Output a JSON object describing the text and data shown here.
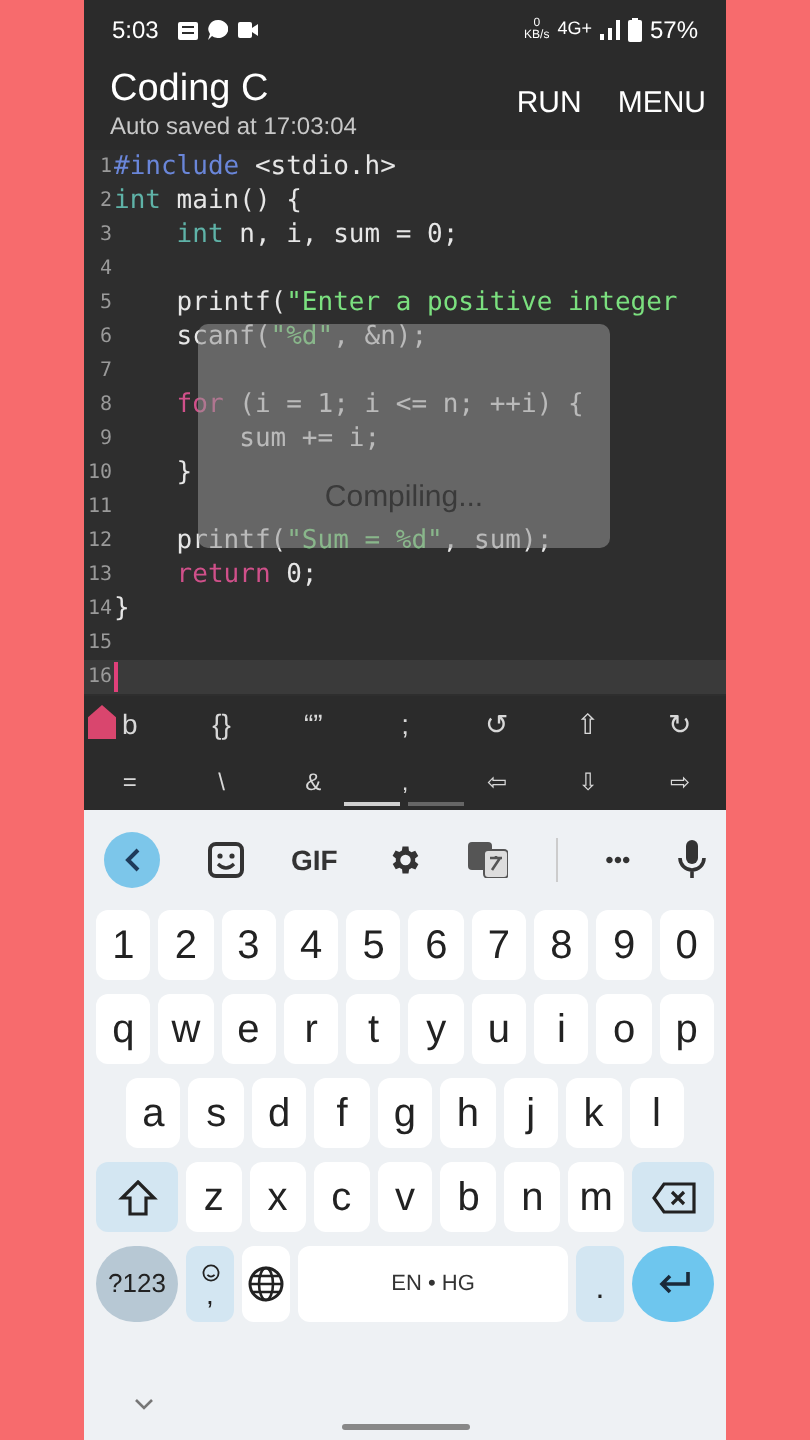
{
  "status_bar": {
    "time": "5:03",
    "speed_value": "0",
    "speed_unit": "KB/s",
    "network": "4G+",
    "battery": "57%"
  },
  "header": {
    "title": "Coding C",
    "subtitle": "Auto saved at 17:03:04",
    "actions": [
      "RUN",
      "MENU"
    ]
  },
  "editor": {
    "lines": [
      {
        "number": "1",
        "current": false,
        "tokens": [
          {
            "kind": "directive",
            "text": "#include"
          },
          {
            "kind": "plain",
            "text": " <stdio.h>"
          }
        ]
      },
      {
        "number": "2",
        "current": false,
        "tokens": [
          {
            "kind": "type",
            "text": "int"
          },
          {
            "kind": "plain",
            "text": " main() {"
          }
        ]
      },
      {
        "number": "3",
        "current": false,
        "tokens": [
          {
            "kind": "type",
            "text": "    int"
          },
          {
            "kind": "plain",
            "text": " n, i, sum = 0;"
          }
        ]
      },
      {
        "number": "4",
        "current": false
      },
      {
        "number": "5",
        "current": false,
        "tokens": [
          {
            "kind": "plain",
            "text": "    printf("
          },
          {
            "kind": "string",
            "text": "\"Enter a positive integer"
          }
        ]
      },
      {
        "number": "6",
        "current": false,
        "tokens": [
          {
            "kind": "plain",
            "text": "    scanf("
          },
          {
            "kind": "string",
            "text": "\"%d\""
          },
          {
            "kind": "plain",
            "text": ", &n);"
          }
        ]
      },
      {
        "number": "7",
        "current": false
      },
      {
        "number": "8",
        "current": false,
        "tokens": [
          {
            "kind": "keyword",
            "text": "    for"
          },
          {
            "kind": "plain",
            "text": " (i = 1; i <= n; ++i) {"
          }
        ]
      },
      {
        "number": "9",
        "current": false,
        "tokens": [
          {
            "kind": "plain",
            "text": "        sum += i;"
          }
        ]
      },
      {
        "number": "10",
        "current": false,
        "tokens": [
          {
            "kind": "plain",
            "text": "    }"
          }
        ]
      },
      {
        "number": "11",
        "current": false
      },
      {
        "number": "12",
        "current": false,
        "tokens": [
          {
            "kind": "plain",
            "text": "    printf("
          },
          {
            "kind": "string",
            "text": "\"Sum = %d\""
          },
          {
            "kind": "plain",
            "text": ", sum);"
          }
        ]
      },
      {
        "number": "13",
        "current": false,
        "tokens": [
          {
            "kind": "keyword",
            "text": "    return"
          },
          {
            "kind": "plain",
            "text": " 0;"
          }
        ]
      },
      {
        "number": "14",
        "current": false,
        "tokens": [
          {
            "kind": "plain",
            "text": "}"
          }
        ]
      },
      {
        "number": "15",
        "current": false
      },
      {
        "number": "16",
        "current": true
      }
    ],
    "overlay": {
      "message": "Compiling..."
    }
  },
  "symbol_bar": [
    [
      "b",
      "{}",
      "“”",
      ";",
      "↺",
      "⇧",
      "↻"
    ],
    [
      "=",
      "\\",
      "&",
      ",",
      "⇦",
      "⇩",
      "⇨"
    ]
  ],
  "keyboard": {
    "toolbar": {
      "gif": "GIF",
      "more": "•••"
    },
    "rows": [
      [
        "1",
        "2",
        "3",
        "4",
        "5",
        "6",
        "7",
        "8",
        "9",
        "0"
      ],
      [
        "q",
        "w",
        "e",
        "r",
        "t",
        "y",
        "u",
        "i",
        "o",
        "p"
      ],
      [
        "a",
        "s",
        "d",
        "f",
        "g",
        "h",
        "j",
        "k",
        "l"
      ],
      [
        "z",
        "x",
        "c",
        "v",
        "b",
        "n",
        "m"
      ]
    ],
    "bottom": {
      "symbols": "?123",
      "comma": ",",
      "space": "EN • HG",
      "period": "."
    }
  }
}
